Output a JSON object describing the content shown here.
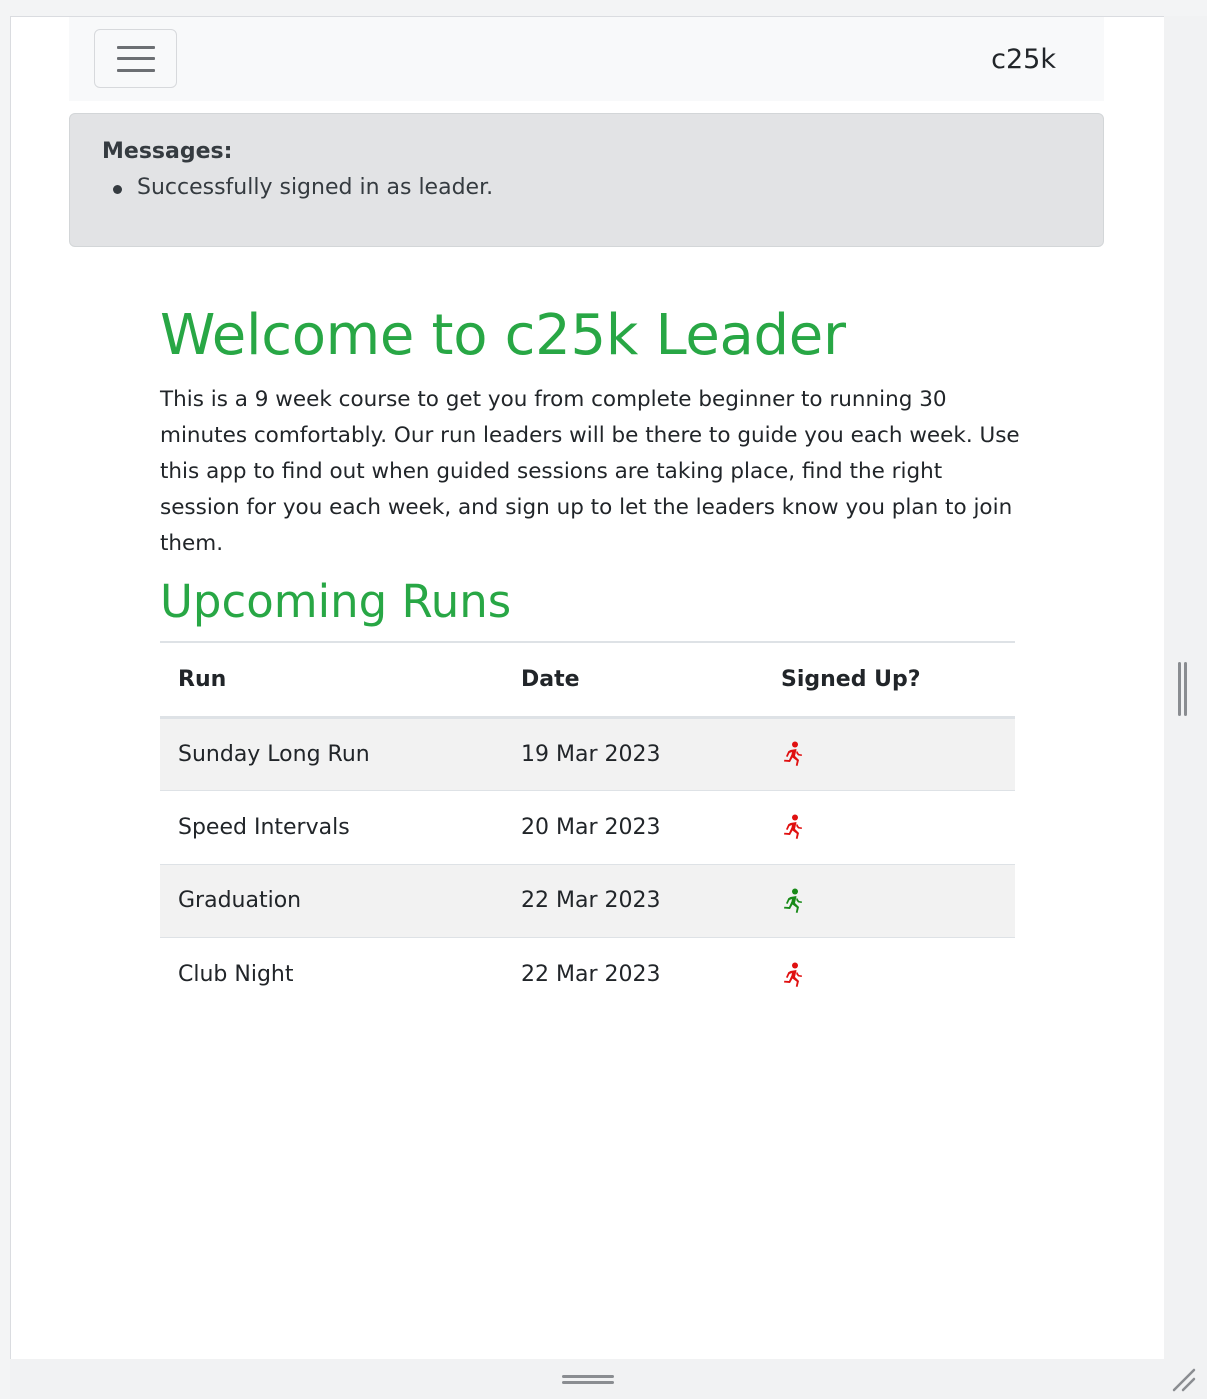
{
  "navbar": {
    "brand": "c25k",
    "toggler_icon": "hamburger-icon"
  },
  "messages": {
    "title": "Messages:",
    "items": [
      "Successfully signed in as leader."
    ]
  },
  "main": {
    "title": "Welcome to c25k Leader",
    "intro": "This is a 9 week course to get you from complete beginner to running 30 minutes comfortably. Our run leaders will be there to guide you each week. Use this app to find out when guided sessions are taking place, find the right session for you each week, and sign up to let the leaders know you plan to join them.",
    "upcoming_title": "Upcoming Runs"
  },
  "table": {
    "headers": [
      "Run",
      "Date",
      "Signed Up?"
    ],
    "rows": [
      {
        "run": "Sunday Long Run",
        "date": "19 Mar 2023",
        "signed_up": false
      },
      {
        "run": "Speed Intervals",
        "date": "20 Mar 2023",
        "signed_up": false
      },
      {
        "run": "Graduation",
        "date": "22 Mar 2023",
        "signed_up": true
      },
      {
        "run": "Club Night",
        "date": "22 Mar 2023",
        "signed_up": false
      }
    ]
  },
  "colors": {
    "accent_green": "#28a745",
    "runner_signed_up": "#188a18",
    "runner_not_signed_up": "#e01010"
  },
  "icons": {
    "runner": "running-person-icon"
  }
}
